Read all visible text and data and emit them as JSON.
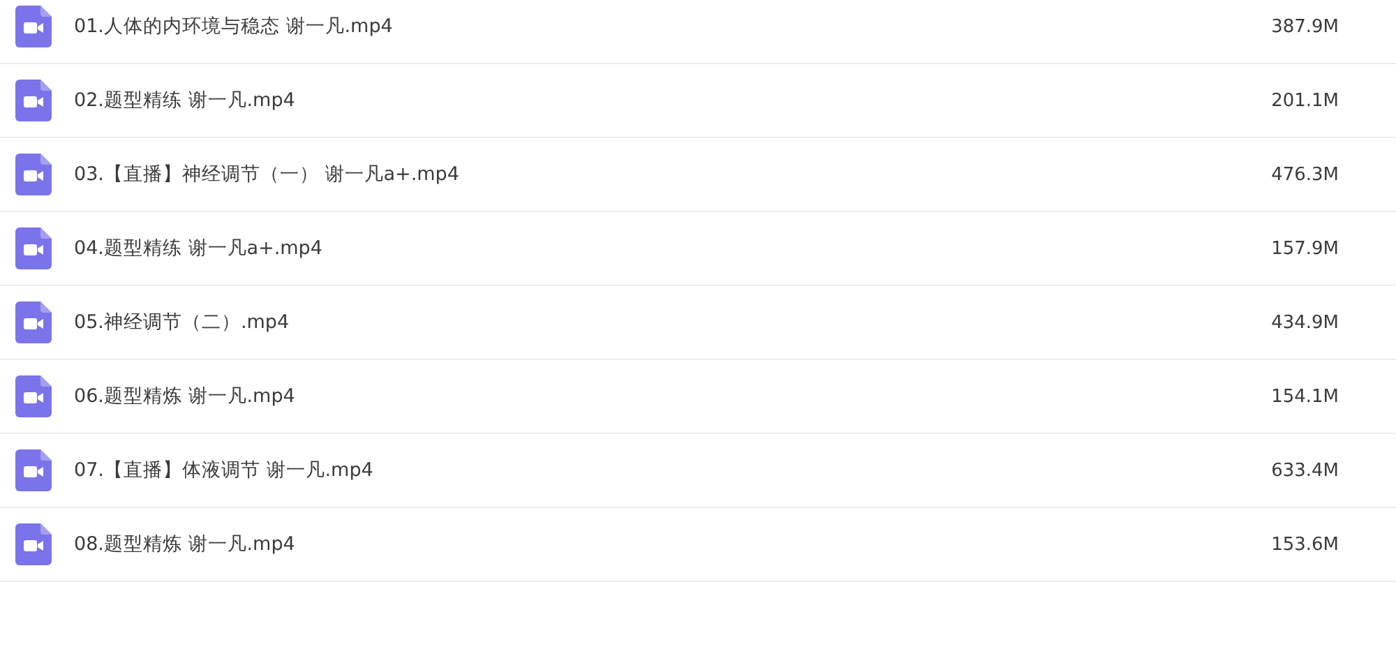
{
  "files": [
    {
      "name": "01.人体的内环境与稳态 谢一凡.mp4",
      "size": "387.9M"
    },
    {
      "name": "02.题型精练 谢一凡.mp4",
      "size": "201.1M"
    },
    {
      "name": "03.【直播】神经调节（一） 谢一凡a+.mp4",
      "size": "476.3M"
    },
    {
      "name": "04.题型精练 谢一凡a+.mp4",
      "size": "157.9M"
    },
    {
      "name": "05.神经调节（二）.mp4",
      "size": "434.9M"
    },
    {
      "name": "06.题型精炼 谢一凡.mp4",
      "size": "154.1M"
    },
    {
      "name": "07.【直播】体液调节 谢一凡.mp4",
      "size": "633.4M"
    },
    {
      "name": "08.题型精炼 谢一凡.mp4",
      "size": "153.6M"
    }
  ]
}
